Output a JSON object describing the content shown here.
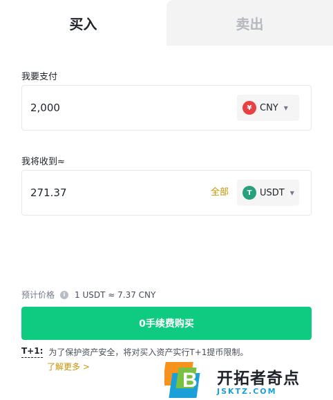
{
  "tabs": [
    {
      "label": "买入",
      "active": true
    },
    {
      "label": "卖出",
      "active": false
    }
  ],
  "pay": {
    "label": "我要支付",
    "value": "2,000",
    "currency": "CNY",
    "currency_icon": "yuan-icon",
    "currency_symbol": "¥",
    "currency_color": "#e84142"
  },
  "receive": {
    "label": "我将收到≈",
    "value": "271.37",
    "all_label": "全部",
    "currency": "USDT",
    "currency_icon": "tether-icon",
    "currency_symbol": "T",
    "currency_color": "#26a17b"
  },
  "price": {
    "label": "预计价格",
    "rate": "1 USDT ≈ 7.37 CNY"
  },
  "buy_button": {
    "label": "0手续费购买"
  },
  "notice": {
    "tag": "T+1:",
    "text": "为了保护资产安全，将对买入资产实行T+1提币限制。",
    "more": "了解更多 >"
  },
  "watermark": {
    "cn": "开拓者奇点",
    "en": "JSKTZ.COM",
    "logo_letter": "B"
  },
  "colors": {
    "accent_green": "#0ecb81",
    "accent_gold": "#c99400",
    "text_primary": "#1e2329",
    "text_secondary": "#707a8a"
  }
}
